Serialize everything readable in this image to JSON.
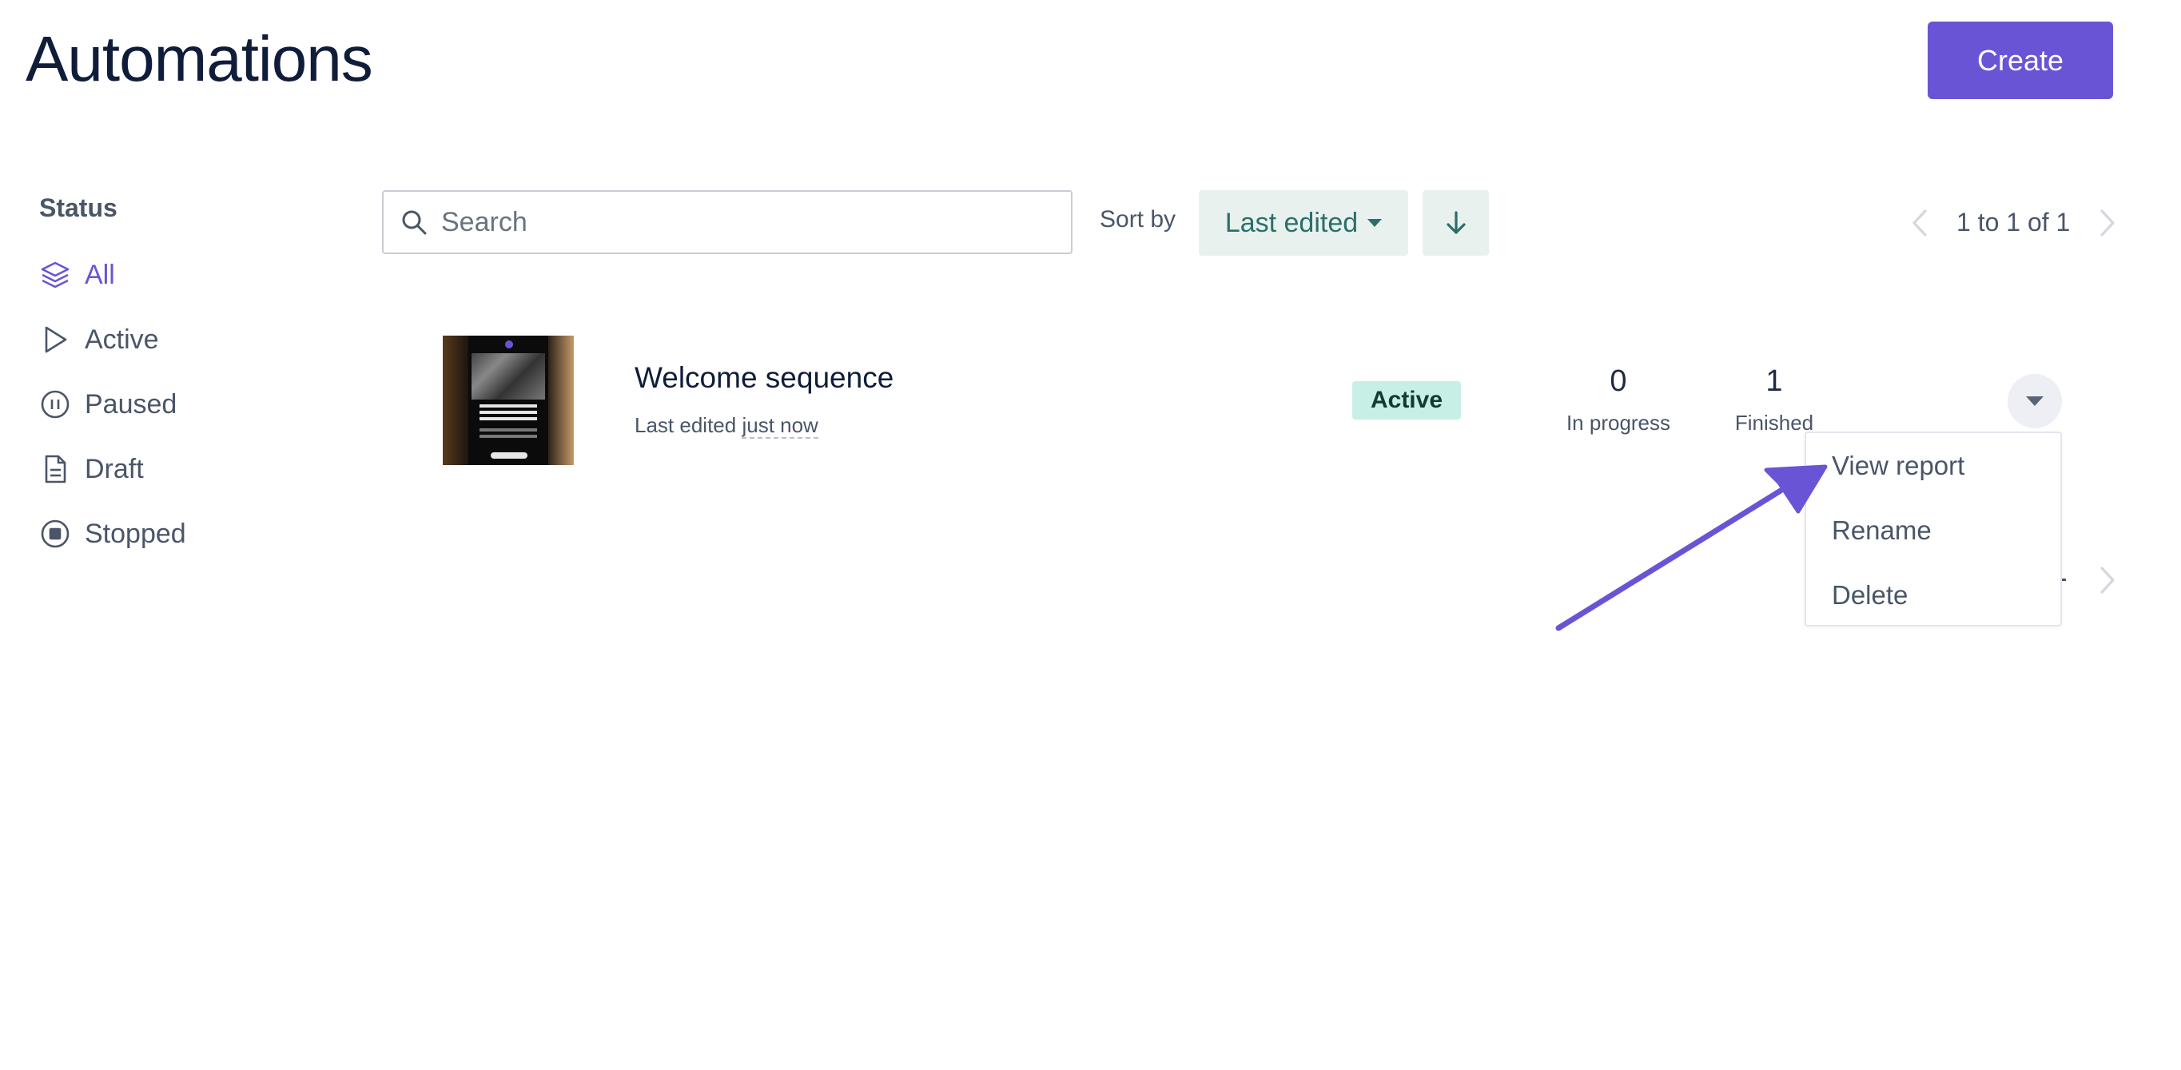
{
  "header": {
    "title": "Automations",
    "create_label": "Create"
  },
  "sidebar": {
    "heading": "Status",
    "items": [
      {
        "label": "All",
        "icon": "layers-icon",
        "selected": true
      },
      {
        "label": "Active",
        "icon": "play-icon"
      },
      {
        "label": "Paused",
        "icon": "pause-icon"
      },
      {
        "label": "Draft",
        "icon": "document-icon"
      },
      {
        "label": "Stopped",
        "icon": "stop-icon"
      }
    ]
  },
  "toolbar": {
    "search_placeholder": "Search",
    "sort_label": "Sort by",
    "sort_value": "Last edited",
    "pagination": "1 to 1 of 1"
  },
  "automation": {
    "name": "Welcome sequence",
    "last_edited_prefix": "Last edited",
    "last_edited_value": "just now",
    "status": "Active",
    "in_progress_count": "0",
    "in_progress_label": "In progress",
    "finished_count": "1",
    "finished_label": "Finished"
  },
  "row_menu": {
    "options": [
      "View report",
      "Rename",
      "Delete"
    ]
  },
  "colors": {
    "accent": "#6a54d6",
    "sort_bg": "#e8f1ee",
    "badge_bg": "#c8efe6"
  }
}
